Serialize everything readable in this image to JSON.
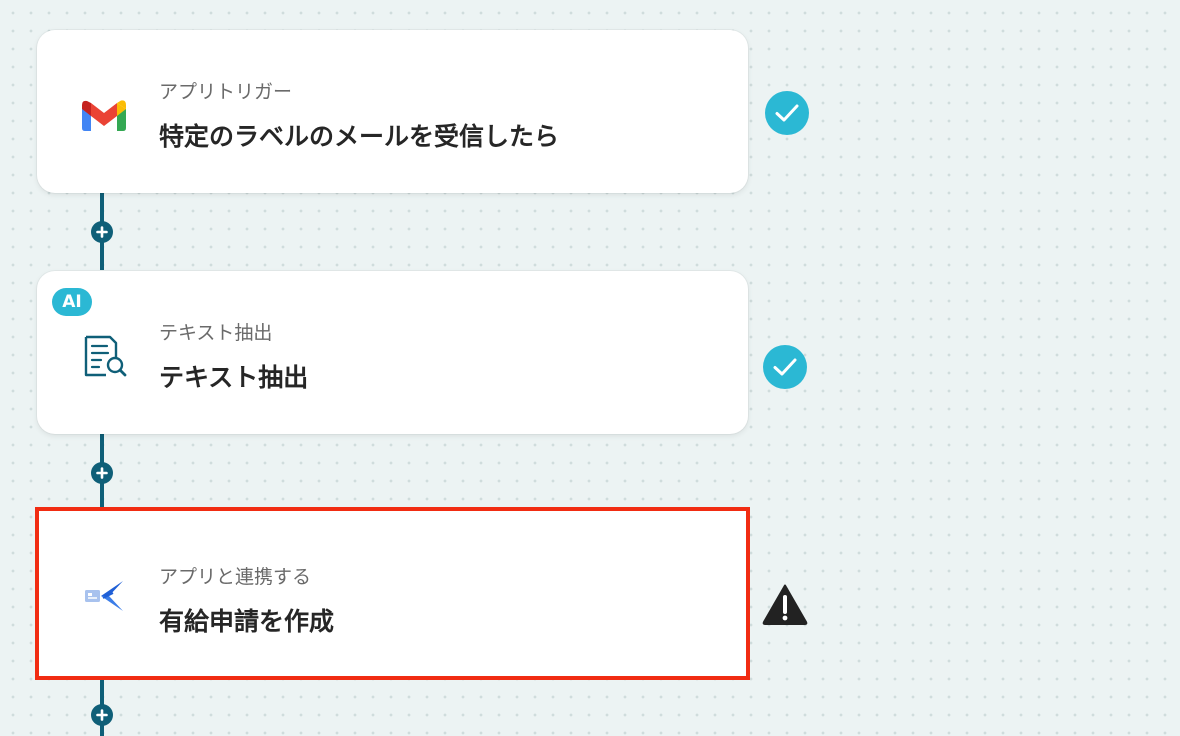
{
  "flow": {
    "steps": [
      {
        "type_label": "アプリトリガー",
        "title": "特定のラベルのメールを受信したら",
        "icon": "gmail-icon",
        "status": "completed"
      },
      {
        "badge": "AI",
        "type_label": "テキスト抽出",
        "title": "テキスト抽出",
        "icon": "document-search-icon",
        "status": "completed"
      },
      {
        "type_label": "アプリと連携する",
        "title": "有給申請を作成",
        "icon": "hr-app-icon",
        "status": "warning",
        "selected": true
      }
    ],
    "add_step_icon": "plus-icon"
  },
  "colors": {
    "connector": "#0f5f78",
    "success": "#2bb8d4",
    "warning": "#222222",
    "selection": "#f12c12",
    "background": "#ecf3f3"
  }
}
